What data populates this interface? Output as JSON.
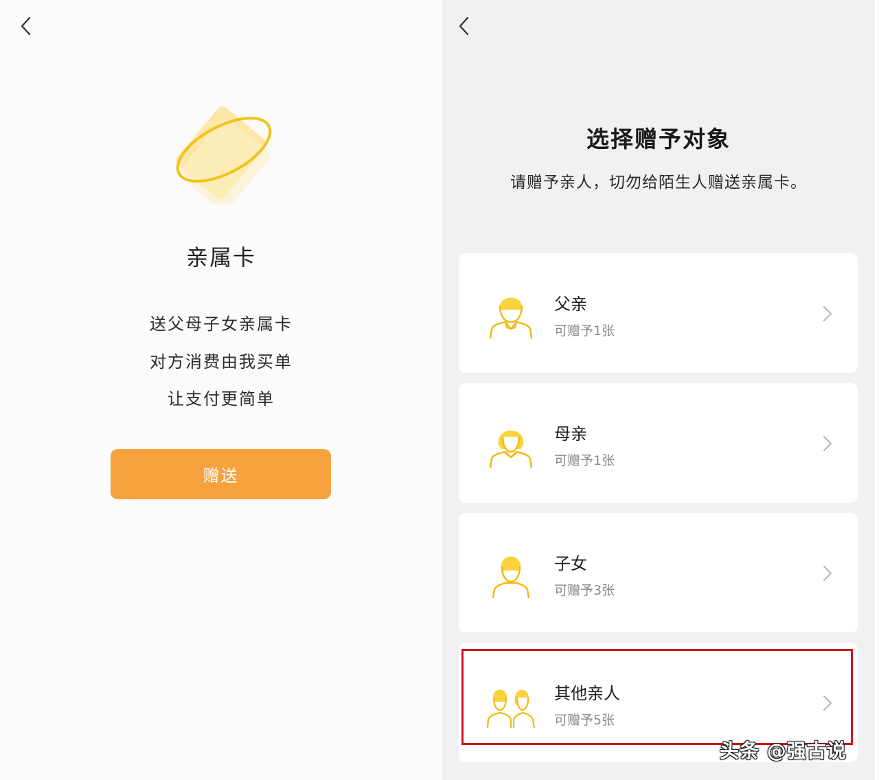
{
  "left": {
    "title": "亲属卡",
    "lines": [
      "送父母子女亲属卡",
      "对方消费由我买单",
      "让支付更简单"
    ],
    "gift_button": "赠送",
    "accent": "#f6a23e",
    "illustration_icon": "card-ring-icon"
  },
  "right": {
    "title": "选择赠予对象",
    "subtitle": "请赠予亲人，切勿给陌生人赠送亲属卡。",
    "options": [
      {
        "name": "父亲",
        "count": "可赠予1张",
        "icon": "father-icon"
      },
      {
        "name": "母亲",
        "count": "可赠予1张",
        "icon": "mother-icon"
      },
      {
        "name": "子女",
        "count": "可赠予3张",
        "icon": "child-icon"
      },
      {
        "name": "其他亲人",
        "count": "可赠予5张",
        "icon": "relatives-icon"
      }
    ],
    "highlight_color": "#d0141c"
  },
  "watermark": "头条 @强古说"
}
